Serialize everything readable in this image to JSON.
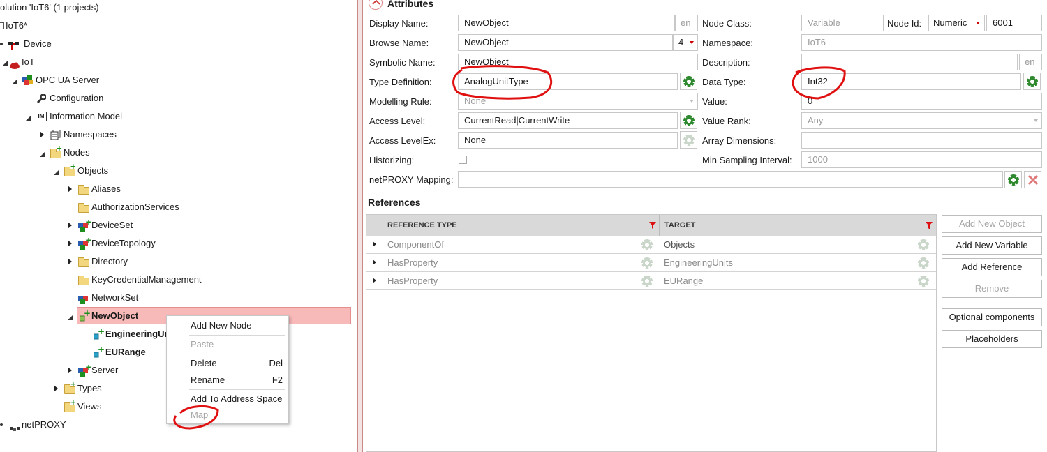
{
  "tree": {
    "solution_title": "olution 'IoT6' (1 projects)",
    "project": "IoT6*",
    "device": "Device",
    "iot": "IoT",
    "opcua_server": "OPC UA Server",
    "configuration": "Configuration",
    "information_model": "Information Model",
    "namespaces": "Namespaces",
    "nodes": "Nodes",
    "objects": "Objects",
    "aliases": "Aliases",
    "authorization_services": "AuthorizationServices",
    "device_set": "DeviceSet",
    "device_topology": "DeviceTopology",
    "directory": "Directory",
    "key_credential_management": "KeyCredentialManagement",
    "network_set": "NetworkSet",
    "new_object": "NewObject",
    "engineering_units": "EngineeringUr",
    "eu_range": "EURange",
    "server": "Server",
    "types": "Types",
    "views": "Views",
    "netproxy": "netPROXY"
  },
  "context_menu": {
    "add_new_node": "Add New Node",
    "paste": "Paste",
    "delete": "Delete",
    "delete_shortcut": "Del",
    "rename": "Rename",
    "rename_shortcut": "F2",
    "add_to_address_space": "Add To Address Space",
    "map": "Map"
  },
  "attributes": {
    "section_title": "Attributes",
    "display_name_label": "Display Name:",
    "display_name_value": "NewObject",
    "display_name_locale": "en",
    "browse_name_label": "Browse Name:",
    "browse_name_value": "NewObject",
    "browse_name_ns": "4",
    "symbolic_name_label": "Symbolic Name:",
    "symbolic_name_value": "NewObject",
    "type_definition_label": "Type Definition:",
    "type_definition_value": "AnalogUnitType",
    "modelling_rule_label": "Modelling Rule:",
    "modelling_rule_value": "None",
    "access_level_label": "Access Level:",
    "access_level_value": "CurrentRead|CurrentWrite",
    "access_levelex_label": "Access LevelEx:",
    "access_levelex_value": "None",
    "historizing_label": "Historizing:",
    "netproxy_mapping_label": "netPROXY Mapping:",
    "node_class_label": "Node Class:",
    "node_class_value": "Variable",
    "node_id_label": "Node Id:",
    "node_id_type": "Numeric",
    "node_id_value": "6001",
    "namespace_label": "Namespace:",
    "namespace_value": "IoT6",
    "description_label": "Description:",
    "description_locale": "en",
    "data_type_label": "Data Type:",
    "data_type_value": "Int32",
    "value_label": "Value:",
    "value_value": "0",
    "value_rank_label": "Value Rank:",
    "value_rank_value": "Any",
    "array_dimensions_label": "Array Dimensions:",
    "min_sampling_label": "Min Sampling Interval:",
    "min_sampling_value": "1000"
  },
  "references": {
    "title": "References",
    "col_reference_type": "REFERENCE TYPE",
    "col_target": "TARGET",
    "rows": [
      {
        "type": "ComponentOf",
        "target": "Objects"
      },
      {
        "type": "HasProperty",
        "target": "EngineeringUnits"
      },
      {
        "type": "HasProperty",
        "target": "EURange"
      }
    ]
  },
  "side_buttons": {
    "add_new_object": "Add New Object",
    "add_new_variable": "Add New Variable",
    "add_reference": "Add Reference",
    "remove": "Remove",
    "optional_components": "Optional components",
    "placeholders": "Placeholders"
  },
  "colors": {
    "selection_bg": "#f8b9b9",
    "annotation_red": "#e01010",
    "gear_green": "#2f8a2f"
  }
}
